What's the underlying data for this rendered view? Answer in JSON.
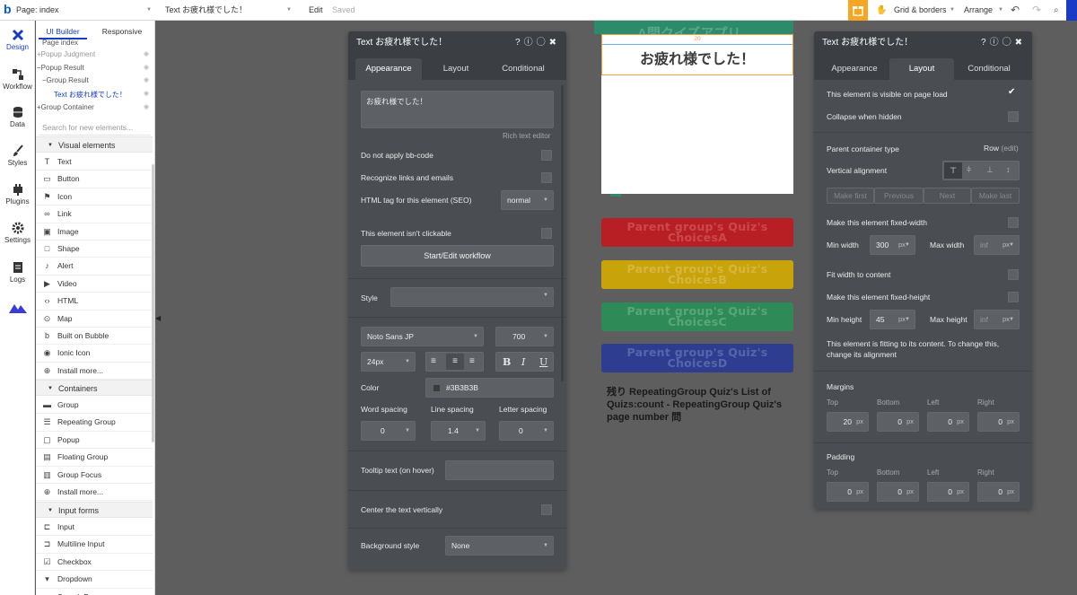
{
  "topbar": {
    "logo": "b",
    "page_label": "Page: index",
    "element_label": "Text お疲れ様でした！",
    "edit": "Edit",
    "saved": "Saved",
    "grid": "Grid & borders",
    "arrange": "Arrange",
    "accent": "#f5a623"
  },
  "leftnav": [
    {
      "label": "Design",
      "icon": "design-icon"
    },
    {
      "label": "Workflow",
      "icon": "workflow-icon"
    },
    {
      "label": "Data",
      "icon": "database-icon"
    },
    {
      "label": "Styles",
      "icon": "brush-icon"
    },
    {
      "label": "Plugins",
      "icon": "plug-icon"
    },
    {
      "label": "Settings",
      "icon": "gear-icon"
    },
    {
      "label": "Logs",
      "icon": "document-icon"
    }
  ],
  "sidebar": {
    "tabs": [
      "UI Builder",
      "Responsive"
    ],
    "tree": [
      {
        "label": "Page index",
        "depth": 1
      },
      {
        "label": "+Popup Judgment",
        "depth": 0
      },
      {
        "label": "−Popup Result",
        "depth": 0
      },
      {
        "label": "−Group Result",
        "depth": 1
      },
      {
        "label": "Text お疲れ様でした！",
        "depth": 2
      },
      {
        "label": "+Group Container",
        "depth": 0
      }
    ],
    "search_placeholder": "Search for new elements...",
    "sections": [
      {
        "label": "Visual elements",
        "items": [
          {
            "label": "Text",
            "icon": "text-icon"
          },
          {
            "label": "Button",
            "icon": "button-icon"
          },
          {
            "label": "Icon",
            "icon": "flag-icon"
          },
          {
            "label": "Link",
            "icon": "link-icon"
          },
          {
            "label": "Image",
            "icon": "image-icon"
          },
          {
            "label": "Shape",
            "icon": "shape-icon"
          },
          {
            "label": "Alert",
            "icon": "bell-icon"
          },
          {
            "label": "Video",
            "icon": "video-icon"
          },
          {
            "label": "HTML",
            "icon": "code-icon"
          },
          {
            "label": "Map",
            "icon": "map-pin-icon"
          },
          {
            "label": "Built on Bubble",
            "icon": "bubble-icon"
          },
          {
            "label": "Ionic Icon",
            "icon": "ionic-icon"
          },
          {
            "label": "Install more...",
            "icon": "plus-icon"
          }
        ]
      },
      {
        "label": "Containers",
        "items": [
          {
            "label": "Group",
            "icon": "group-icon"
          },
          {
            "label": "Repeating Group",
            "icon": "repeating-group-icon"
          },
          {
            "label": "Popup",
            "icon": "popup-icon"
          },
          {
            "label": "Floating Group",
            "icon": "floating-group-icon"
          },
          {
            "label": "Group Focus",
            "icon": "group-focus-icon"
          },
          {
            "label": "Install more...",
            "icon": "plus-icon"
          }
        ]
      },
      {
        "label": "Input forms",
        "items": [
          {
            "label": "Input",
            "icon": "input-icon"
          },
          {
            "label": "Multiline Input",
            "icon": "multiline-input-icon"
          },
          {
            "label": "Checkbox",
            "icon": "checkbox-icon"
          },
          {
            "label": "Dropdown",
            "icon": "dropdown-icon"
          },
          {
            "label": "Search Box",
            "icon": "search-icon"
          }
        ]
      }
    ]
  },
  "canvas": {
    "header_partial": "A問クイズアプリ",
    "ruler_value": "20",
    "selected_text": "お疲れ様でした！",
    "choices": [
      {
        "label": "Parent group's Quiz's ChoicesA",
        "color": "#b81f24",
        "text_color": "#c14a4d"
      },
      {
        "label": "Parent group's Quiz's ChoicesB",
        "color": "#c9a30a",
        "text_color": "#d2b23c"
      },
      {
        "label": "Parent group's Quiz's ChoicesC",
        "color": "#2e8b57",
        "text_color": "#53a273"
      },
      {
        "label": "Parent group's Quiz's ChoicesD",
        "color": "#2e3d8f",
        "text_color": "#5261a6"
      }
    ],
    "dynamic_text": "残り RepeatingGroup Quiz's List of Quizs:count - RepeatingGroup Quiz's page number 問"
  },
  "appearance_panel": {
    "title": "Text お疲れ様でした！",
    "tabs": [
      "Appearance",
      "Layout",
      "Conditional"
    ],
    "content_value": "お疲れ様でした！",
    "rich_text_editor": "Rich text editor",
    "no_bbcode": "Do not apply bb-code",
    "recognize_links": "Recognize links and emails",
    "html_tag_label": "HTML tag for this element (SEO)",
    "html_tag_value": "normal",
    "not_clickable": "This element isn't clickable",
    "workflow_button": "Start/Edit workflow",
    "style_label": "Style",
    "font_family": "Noto Sans JP",
    "font_weight": "700",
    "font_size": "24px",
    "bold": "B",
    "italic": "I",
    "underline": "U",
    "color_label": "Color",
    "color_value": "#3B3B3B",
    "word_spacing_label": "Word spacing",
    "line_spacing_label": "Line spacing",
    "letter_spacing_label": "Letter spacing",
    "word_spacing": "0",
    "line_spacing": "1.4",
    "letter_spacing": "0",
    "tooltip_label": "Tooltip text (on hover)",
    "center_vertical": "Center the text vertically",
    "background_label": "Background style",
    "background_value": "None"
  },
  "layout_panel": {
    "title": "Text お疲れ様でした！",
    "tabs": [
      "Appearance",
      "Layout",
      "Conditional"
    ],
    "visible_on_load": "This element is visible on page load",
    "collapse_hidden": "Collapse when hidden",
    "parent_type_label": "Parent container type",
    "parent_type_value": "Row",
    "parent_type_edit": "(edit)",
    "vertical_alignment": "Vertical alignment",
    "order_buttons": [
      "Make first",
      "Previous",
      "Next",
      "Make last"
    ],
    "fixed_width": "Make this element fixed-width",
    "min_width_label": "Min width",
    "min_width": "300",
    "max_width_label": "Max width",
    "max_width": "inf",
    "unit": "px",
    "fit_width": "Fit width to content",
    "fixed_height": "Make this element fixed-height",
    "min_height_label": "Min height",
    "min_height": "45",
    "max_height_label": "Max height",
    "max_height": "inf",
    "fitting_note": "This element is fitting to its content. To change this, change its alignment",
    "margins_label": "Margins",
    "padding_label": "Padding",
    "side_labels": [
      "Top",
      "Bottom",
      "Left",
      "Right"
    ],
    "margins": [
      "20",
      "0",
      "0",
      "0"
    ],
    "padding": [
      "0",
      "0",
      "0",
      "0"
    ]
  }
}
